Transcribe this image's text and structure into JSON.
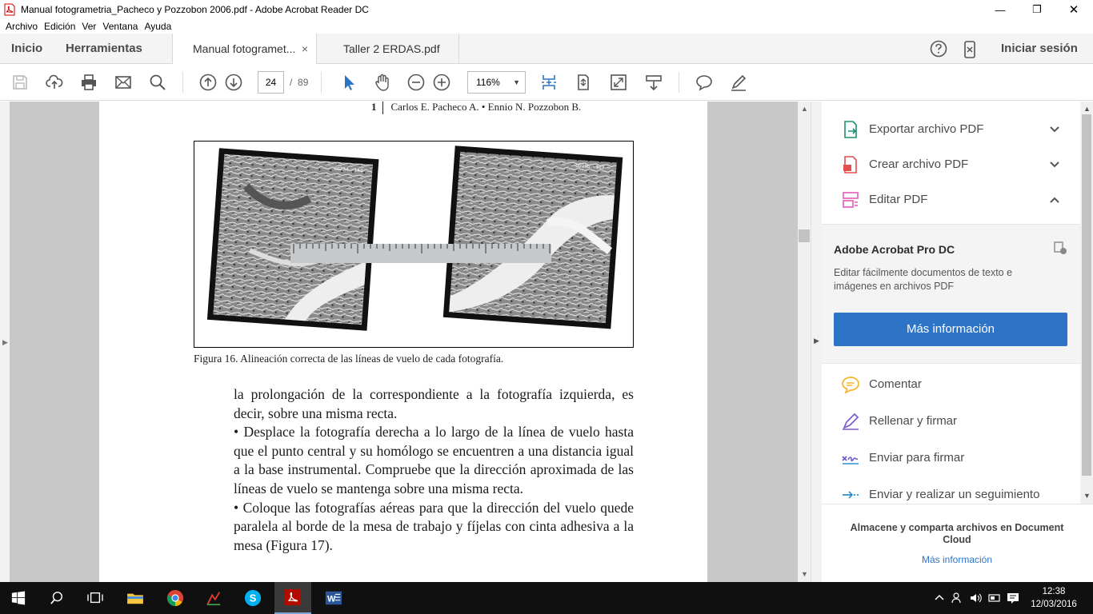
{
  "window": {
    "title": "Manual fotogrametria_Pacheco y Pozzobon 2006.pdf - Adobe Acrobat Reader DC",
    "controls": {
      "minimize": "—",
      "maximize": "❐",
      "close": "✕"
    }
  },
  "menu": [
    "Archivo",
    "Edición",
    "Ver",
    "Ventana",
    "Ayuda"
  ],
  "tabs": {
    "home": "Inicio",
    "tools": "Herramientas",
    "documents": [
      {
        "label": "Manual fotogramet...",
        "active": true,
        "close": "×"
      },
      {
        "label": "Taller 2 ERDAS.pdf",
        "active": false
      }
    ],
    "help_icon": "help-icon",
    "signin": "Iniciar sesión"
  },
  "toolbar": {
    "current_page": "24",
    "page_separator": "/",
    "total_pages": "89",
    "zoom": "116%",
    "icons": [
      "save-icon",
      "upload-icon",
      "print-icon",
      "email-icon",
      "search-icon",
      "page-up-icon",
      "page-down-icon",
      "select-cursor-icon",
      "hand-icon",
      "zoom-out-icon",
      "zoom-in-icon",
      "fit-page-icon",
      "scrolling-mode-icon",
      "full-screen-icon",
      "read-mode-icon",
      "comment-icon",
      "sign-icon"
    ]
  },
  "document": {
    "header_number": "1",
    "header_authors": "Carlos E. Pacheco A. • Ennio N. Pozzobon B.",
    "figure_caption": "Figura 16. Alineación correcta de las líneas de vuelo de cada fotografía.",
    "figure_labels": {
      "left_photo": "GG234 ~163",
      "right_photo": "GG235 ~163"
    },
    "paragraphs": [
      "la prolongación de la correspondiente a la fotografía izquierda, es decir, sobre una misma recta.",
      "• Desplace la fotografía derecha a lo largo de la línea de vuelo hasta que el punto central y su homólogo se encuentren a una distancia igual a la base instrumental. Compruebe que la dirección aproximada de las líneas de vuelo se mantenga sobre una misma recta.",
      "• Coloque las fotografías aéreas para que la dirección del vuelo quede paralela al borde de la mesa de trabajo y fíjelas con cinta adhesiva a la mesa (Figura 17)."
    ]
  },
  "right_panel": {
    "tools_top": [
      {
        "label": "Exportar archivo PDF",
        "icon": "export-pdf-icon",
        "chevron": "chevron-down-icon",
        "color": "#1e8f6e"
      },
      {
        "label": "Crear archivo PDF",
        "icon": "create-pdf-icon",
        "chevron": "chevron-down-icon",
        "color": "#e34f4f"
      },
      {
        "label": "Editar PDF",
        "icon": "edit-pdf-icon",
        "chevron": "chevron-up-icon",
        "color": "#e05bb5"
      }
    ],
    "promo": {
      "title": "Adobe Acrobat Pro DC",
      "description": "Editar fácilmente documentos de texto e imágenes en archivos PDF",
      "button": "Más información"
    },
    "tools_bottom": [
      {
        "label": "Comentar",
        "icon": "comment-tool-icon",
        "color": "#f5b531"
      },
      {
        "label": "Rellenar y firmar",
        "icon": "fill-sign-icon",
        "color": "#7a5ccc"
      },
      {
        "label": "Enviar para firmar",
        "icon": "send-sign-icon",
        "color": "#6a5acd"
      },
      {
        "label": "Enviar y realizar un seguimiento",
        "icon": "send-track-icon",
        "color": "#2a8fd6"
      }
    ],
    "cloud": {
      "text": "Almacene y comparta archivos en Document Cloud",
      "link": "Más información"
    }
  },
  "taskbar": {
    "time": "12:38",
    "date": "12/03/2016",
    "apps": [
      "start-icon",
      "search-icon",
      "task-view-icon",
      "file-explorer-icon",
      "chrome-icon",
      "app-icon",
      "skype-icon",
      "acrobat-icon",
      "word-icon"
    ]
  },
  "colors": {
    "accent_blue": "#2d74c6",
    "viewer_bg": "#c8c8c8",
    "taskbar": "#101010"
  }
}
